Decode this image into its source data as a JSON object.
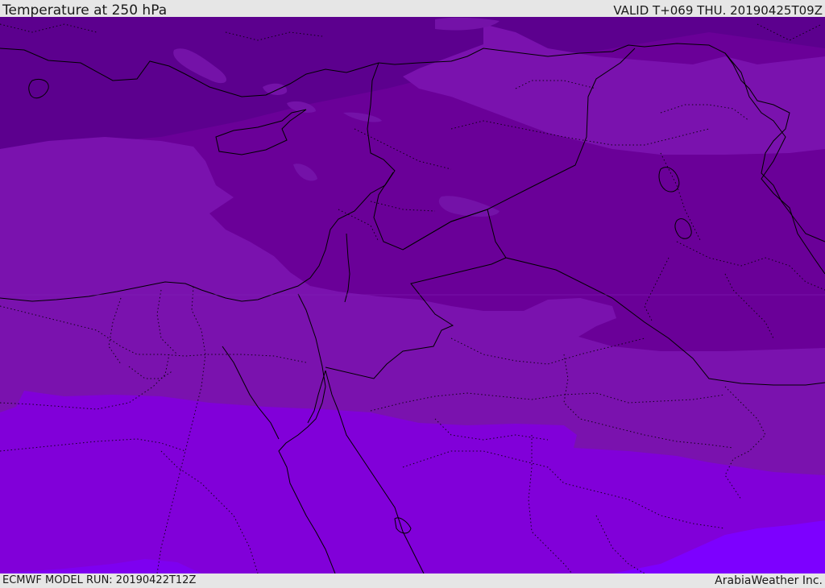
{
  "header": {
    "title": "Temperature at 250 hPa",
    "valid": "VALID T+069 THU. 20190425T09Z"
  },
  "footer": {
    "model_run": "ECMWF MODEL RUN: 20190422T12Z",
    "credit": "ArabiaWeather Inc."
  },
  "map": {
    "field": "temperature-250hPa",
    "colors": {
      "darkest_band": "#5e0090",
      "mid_band": "#6a0098",
      "light_band": "#7a12ae",
      "violet_band": "#8100d9",
      "bright_band": "#7d00ff",
      "border_line": "#000000",
      "page_background": "#e6e6e6"
    }
  }
}
